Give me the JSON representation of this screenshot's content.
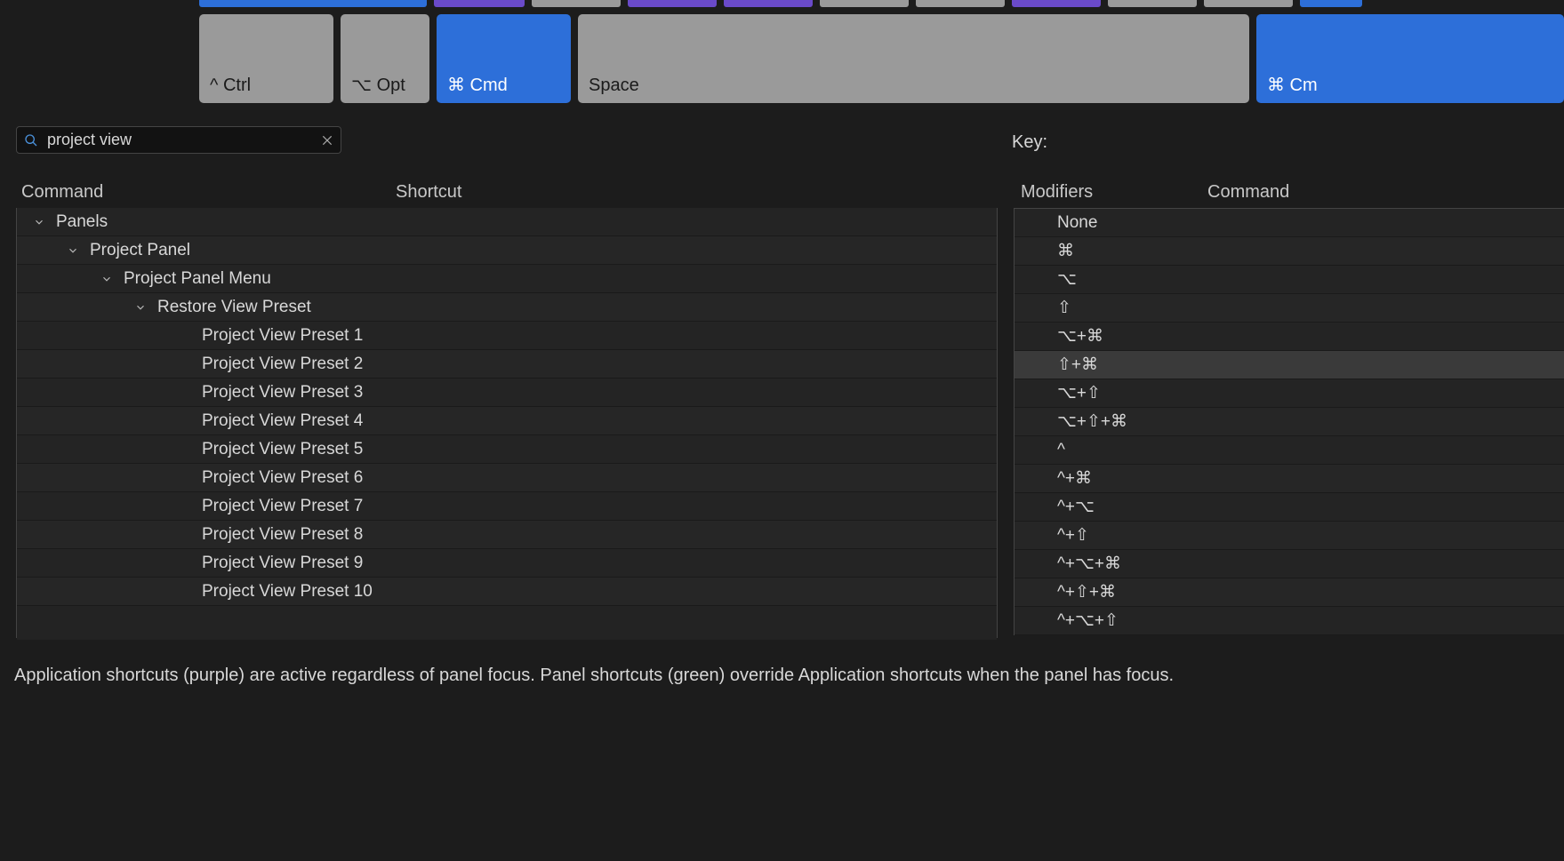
{
  "keyboard": {
    "ctrl": "^ Ctrl",
    "opt": "⌥ Opt",
    "cmd": "⌘ Cmd",
    "space": "Space",
    "cmd_right": "⌘ Cm"
  },
  "search": {
    "value": "project view"
  },
  "key_label": "Key:",
  "headers": {
    "command": "Command",
    "shortcut": "Shortcut",
    "modifiers": "Modifiers",
    "command2": "Command"
  },
  "tree": {
    "panels": "Panels",
    "project_panel": "Project Panel",
    "project_panel_menu": "Project Panel Menu",
    "restore_view_preset": "Restore View Preset",
    "presets": [
      "Project View Preset 1",
      "Project View Preset 2",
      "Project View Preset 3",
      "Project View Preset 4",
      "Project View Preset 5",
      "Project View Preset 6",
      "Project View Preset 7",
      "Project View Preset 8",
      "Project View Preset 9",
      "Project View Preset 10"
    ]
  },
  "modifiers": [
    "None",
    "⌘",
    "⌥",
    "⇧",
    "⌥+⌘",
    "⇧+⌘",
    "⌥+⇧",
    "⌥+⇧+⌘",
    "^",
    "^+⌘",
    "^+⌥",
    "^+⇧",
    "^+⌥+⌘",
    "^+⇧+⌘",
    "^+⌥+⇧"
  ],
  "modifiers_selected_index": 5,
  "footer": "Application shortcuts (purple) are active regardless of panel focus. Panel shortcuts (green) override Application shortcuts when the panel has focus."
}
